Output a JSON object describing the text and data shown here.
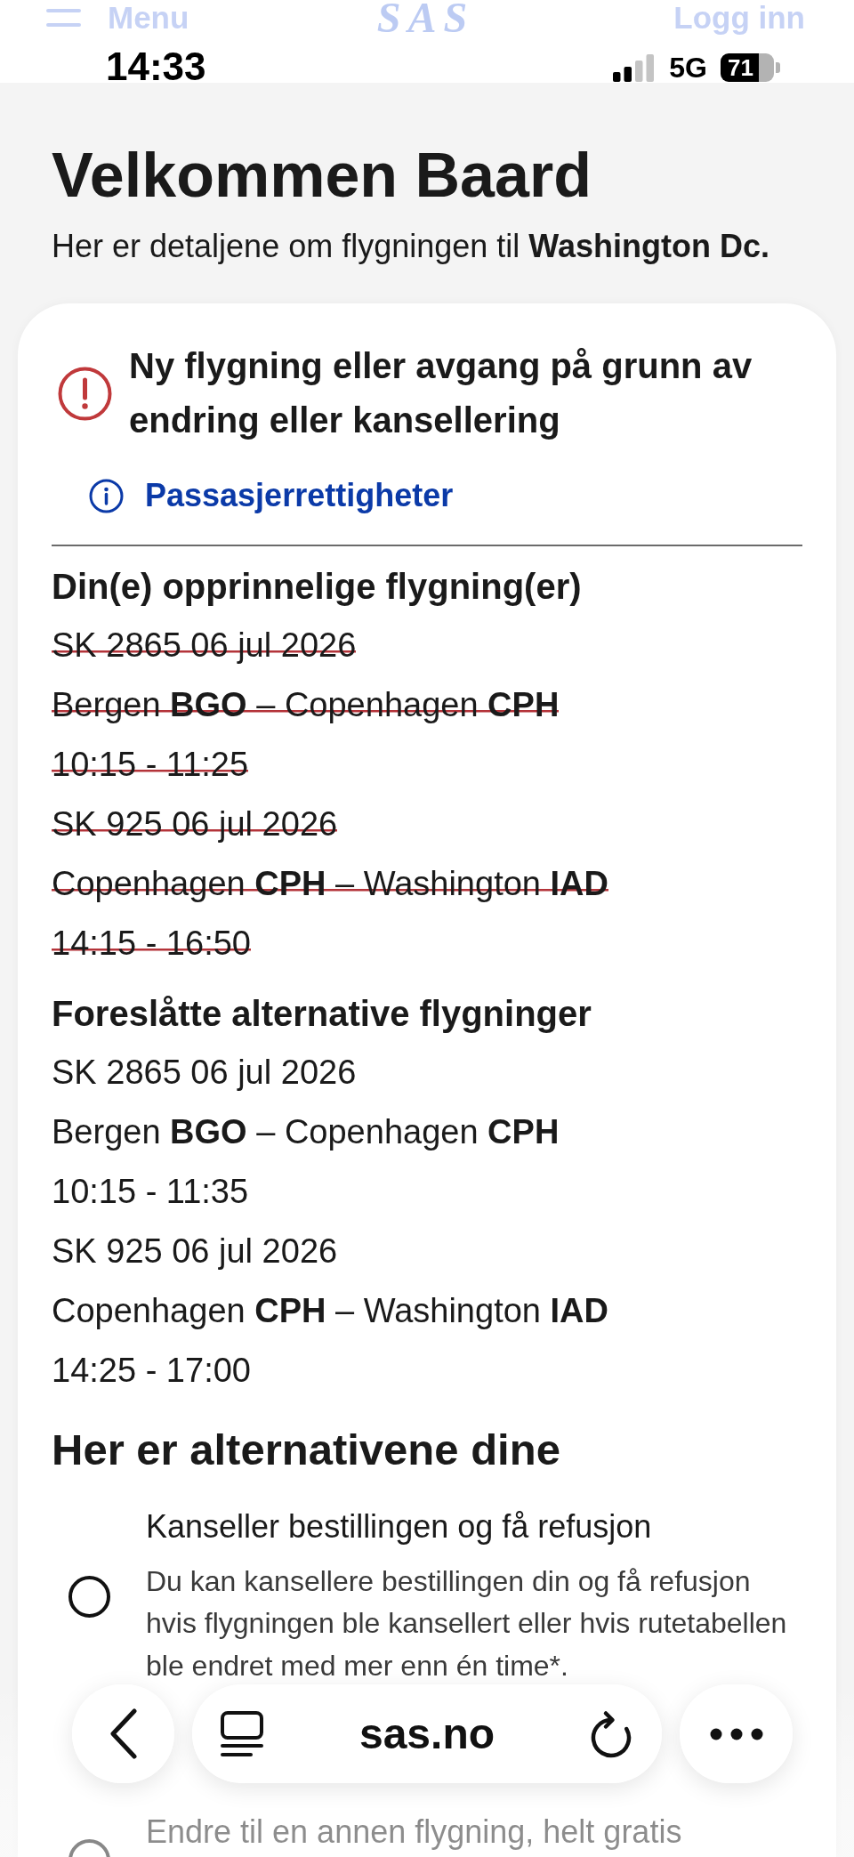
{
  "site_header": {
    "menu_label": "Menu",
    "logo": "SAS",
    "login_label": "Logg inn"
  },
  "status_bar": {
    "time": "14:33",
    "network": "5G",
    "battery": "71"
  },
  "intro": {
    "title": "Velkommen Baard",
    "subtitle": "Her er detaljene om flygningen til **Washington Dc.**"
  },
  "notice": {
    "kind": "error",
    "title": "Ny flygning eller avgang på grunn av endring eller kansellering",
    "link": "Passasjerrettigheter"
  },
  "flight_sections": [
    {
      "title": "Din(e) opprinnelige flygning(er)",
      "cancelled": true,
      "lines": [
        "SK 2865 06 jul 2026",
        "Bergen **BGO** – Copenhagen **CPH**",
        "10:15 - 11:25",
        "SK 925 06 jul 2026",
        "Copenhagen **CPH** – Washington **IAD**",
        "14:15 - 16:50"
      ]
    },
    {
      "title": "Foreslåtte alternative flygninger",
      "cancelled": false,
      "lines": [
        "SK 2865 06 jul 2026",
        "Bergen **BGO** – Copenhagen **CPH**",
        "10:15 - 11:35",
        "SK 925 06 jul 2026",
        "Copenhagen **CPH** – Washington **IAD**",
        "14:25 - 17:00"
      ]
    }
  ],
  "options_section": {
    "title": "Her er alternativene dine",
    "options": [
      {
        "title": "Kanseller bestillingen og få refusjon",
        "description": "Du kan kansellere bestillingen din og få refusjon hvis flygningen ble kansellert eller hvis rutetabellen ble endret med mer enn én time*.",
        "selected": false
      },
      {
        "title": "Endre til en annen flygning, helt gratis",
        "selected": false
      }
    ]
  },
  "browser_toolbar": {
    "url": "sas.no"
  }
}
